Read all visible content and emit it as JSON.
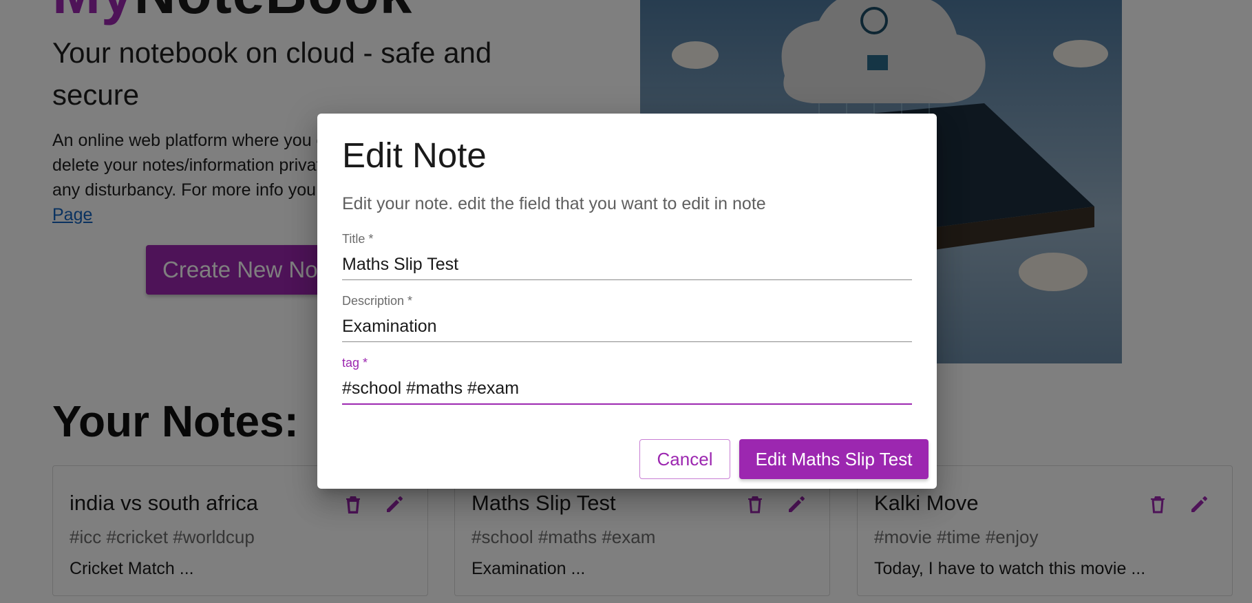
{
  "colors": {
    "accent": "#9c27b0",
    "link": "#1565c0"
  },
  "hero": {
    "brand_prefix": "My",
    "brand_rest": "NoteBook",
    "tagline": "Your notebook on cloud - safe and secure",
    "intro_text": "An online web platform where you can create, edit, upload, delete your notes/information privately and securely without any disturbancy. For more info you can checkout our",
    "about_link": "About Page",
    "create_button": "Create New Note"
  },
  "notes_section": {
    "heading": "Your Notes:",
    "cards": [
      {
        "title": "india vs south africa",
        "tags": "#icc #cricket #worldcup",
        "description": "Cricket Match ...",
        "delete_icon": "trash-icon",
        "edit_icon": "pencil-icon"
      },
      {
        "title": "Maths Slip Test",
        "tags": "#school #maths #exam",
        "description": "Examination ...",
        "delete_icon": "trash-icon",
        "edit_icon": "pencil-icon"
      },
      {
        "title": "Kalki Move",
        "tags": "#movie #time #enjoy",
        "description": "Today, I have to watch this movie ...",
        "delete_icon": "trash-icon",
        "edit_icon": "pencil-icon"
      }
    ]
  },
  "dialog": {
    "title": "Edit Note",
    "subtitle": "Edit your note. edit the field that you want to edit in note",
    "fields": {
      "title": {
        "label": "Title *",
        "value": "Maths Slip Test"
      },
      "description": {
        "label": "Description *",
        "value": "Examination"
      },
      "tag": {
        "label": "tag *",
        "value": "#school #maths #exam"
      }
    },
    "cancel_button": "Cancel",
    "submit_button": "Edit Maths Slip Test"
  }
}
